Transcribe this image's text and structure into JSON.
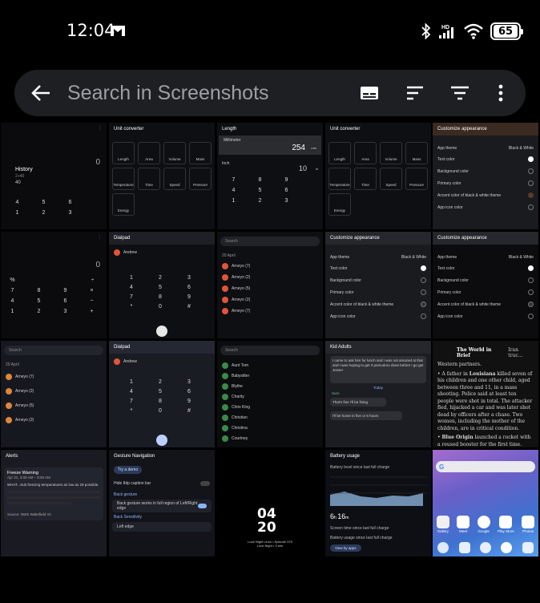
{
  "status": {
    "time": "12:04",
    "battery": "65",
    "hd_label": "HD"
  },
  "search": {
    "placeholder": "Search in Screenshots"
  },
  "icons": [
    "back-arrow-icon",
    "caption-icon",
    "sort-icon",
    "filter-icon",
    "more-vert-icon"
  ],
  "thumbs": {
    "t1": {
      "title": "History",
      "n1": "2+40",
      "n2": "40",
      "keys": [
        "4",
        "5",
        "6",
        "1",
        "2",
        "3"
      ],
      "zero": "0"
    },
    "t2": {
      "title": "Unit converter",
      "tiles": [
        "Length",
        "Area",
        "Volume",
        "Mass",
        "Temperature",
        "Time",
        "Speed",
        "Pressure",
        "Energy"
      ]
    },
    "t3": {
      "title": "Length",
      "unit1": "Millimeter",
      "val1": "254",
      "unit1s": "mm",
      "unit2": "Inch",
      "val2": "10",
      "unit2s": "in",
      "keys": [
        "7",
        "8",
        "9",
        "4",
        "5",
        "6",
        "1",
        "2",
        "3"
      ]
    },
    "t4": {
      "title": "Unit converter",
      "tiles": [
        "Length",
        "Area",
        "Volume",
        "Mass",
        "Temperature",
        "Time",
        "Speed",
        "Pressure",
        "Energy"
      ]
    },
    "t5": {
      "title": "Customize appearance",
      "rows": [
        "App theme",
        "Text color",
        "Background color",
        "Primary color",
        "Accent color of black & white theme",
        "App icon color"
      ],
      "theme_val": "Black & White"
    },
    "t6": {
      "zero": "0",
      "keys": [
        "%",
        "÷",
        "7",
        "8",
        "9",
        "×",
        "4",
        "5",
        "6",
        "−",
        "1",
        "2",
        "3",
        "+"
      ]
    },
    "t7": {
      "title": "Dialpad",
      "contact": "Andrew",
      "keys": [
        "1",
        "2",
        "3",
        "4",
        "5",
        "6",
        "7",
        "8",
        "9",
        "*",
        "0",
        "#"
      ]
    },
    "t8": {
      "search": "Search",
      "date": "20 April",
      "items": [
        "Arneyo (7)",
        "Arneyo (2)",
        "Arneyo (5)",
        "Arneyo (2)",
        "Arneyo (7)"
      ]
    },
    "t9": {
      "title": "Customize appearance",
      "rows": [
        "App theme",
        "Text color",
        "Background color",
        "Primary color",
        "Accent color of black & white theme",
        "App icon color"
      ],
      "theme_val": "Black & White"
    },
    "t10": {
      "title": "Customize appearance",
      "rows": [
        "App theme",
        "Text color",
        "Background color",
        "Primary color",
        "Accent color of black & white theme",
        "App icon color"
      ],
      "theme_val": "Black & White"
    },
    "t11": {
      "search": "Search",
      "date": "20 April",
      "items": [
        "Arneyo (7)",
        "Arneyo (2)",
        "Arneyo (5)",
        "Arneyo (2)"
      ]
    },
    "t12": {
      "title": "Dialpad",
      "contact": "Andrew",
      "keys": [
        "1",
        "2",
        "3",
        "4",
        "5",
        "6",
        "7",
        "8",
        "9",
        "*",
        "0",
        "#"
      ]
    },
    "t13": {
      "search": "Search",
      "contacts": [
        "Aunt Tom",
        "Babysitter",
        "Blythe",
        "Charity",
        "Chris King",
        "Christian",
        "Christina",
        "Courtney"
      ]
    },
    "t14": {
      "title": "Kid Adults",
      "msg1": "I came to ask him for lunch and I was not amazed at that and I was hoping to get 3 pomodoro done before I go get Jesse!",
      "today": "Today",
      "me1": "Sure",
      "msg2": "That's fine I'll be fixing",
      "me2": "I'll be home in five or 6 hours"
    },
    "t15": {
      "title": "The World in Brief",
      "tail": "Iran truc...",
      "p0": "Western partners.",
      "p1a": "A father in ",
      "p1b": "Louisiana",
      "p1c": " killed seven of his children and one other child, aged between three and 11, in a mass shooting. Police said at least ten people were shot in total. The attacker fled, hijacked a car and was later shot dead by officers after a chase. Two women, including the mother of the children, are in critical condition.",
      "p2a": "Blue Origin",
      "p2b": " launched a rocket with a reused booster for the first time. Although"
    },
    "t16": {
      "title": "Alerts",
      "warn": "Freeze Warning",
      "when": "Apr 21, 3:00 AM – 9:00 AM",
      "body": "WHAT...Sub freezing temperatures as low as 29 possible.",
      "source": "Source: NWS Wakefield VA"
    },
    "t17": {
      "title": "Gesture Navigation",
      "demo": "Try a demo",
      "row1": "Hide 8dp caption bar",
      "hdr2": "Back gesture",
      "row2": "Back gesture works in full region of Left/Right edge",
      "hdr3": "Back Sensitivity",
      "row3": "Left edge"
    },
    "t18": {
      "time1": "04",
      "time2": "20",
      "line1": "Love Night Linux • Episode 375",
      "line2": "Love Night • 3 min"
    },
    "t19": {
      "title": "Battery usage",
      "sub": "Battery level since last full charge",
      "h": "6",
      "m": "16",
      "label2": "Screen time since last full charge",
      "label3": "Battery usage since last full charge",
      "btn": "View by apps"
    },
    "t20": {
      "apps": [
        "Gallery",
        "Meet",
        "Google",
        "Play Store",
        "Photos",
        "Contacts",
        "Camera"
      ]
    }
  }
}
